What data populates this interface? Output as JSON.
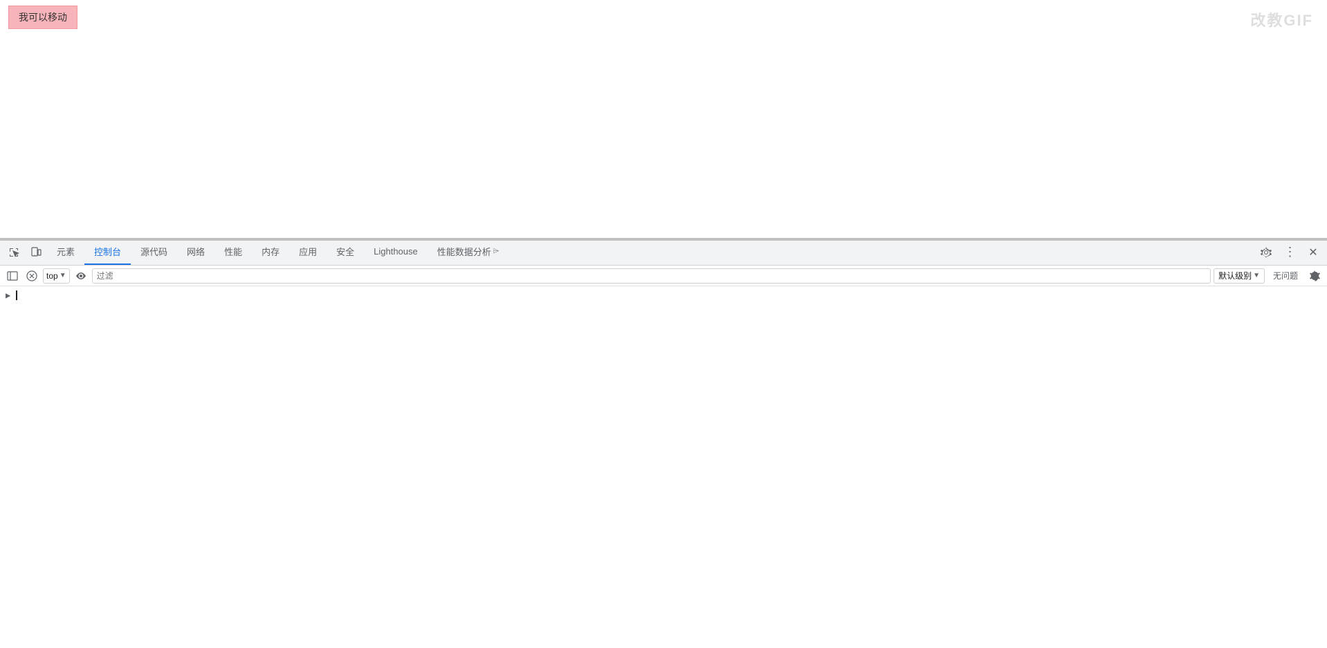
{
  "watermark": {
    "text": "改教GIF"
  },
  "page": {
    "draggable_label": "我可以移动"
  },
  "devtools": {
    "tabs": [
      {
        "id": "elements",
        "label": "元素",
        "active": false
      },
      {
        "id": "console",
        "label": "控制台",
        "active": true
      },
      {
        "id": "sources",
        "label": "源代码",
        "active": false
      },
      {
        "id": "network",
        "label": "网络",
        "active": false
      },
      {
        "id": "performance",
        "label": "性能",
        "active": false
      },
      {
        "id": "memory",
        "label": "内存",
        "active": false
      },
      {
        "id": "application",
        "label": "应用",
        "active": false
      },
      {
        "id": "security",
        "label": "安全",
        "active": false
      },
      {
        "id": "lighthouse",
        "label": "Lighthouse",
        "active": false
      },
      {
        "id": "performance-insights",
        "label": "性能数据分析",
        "active": false
      }
    ],
    "console": {
      "top_label": "top",
      "filter_placeholder": "过滤",
      "level_label": "默认级别",
      "no_issues": "无问题"
    }
  }
}
